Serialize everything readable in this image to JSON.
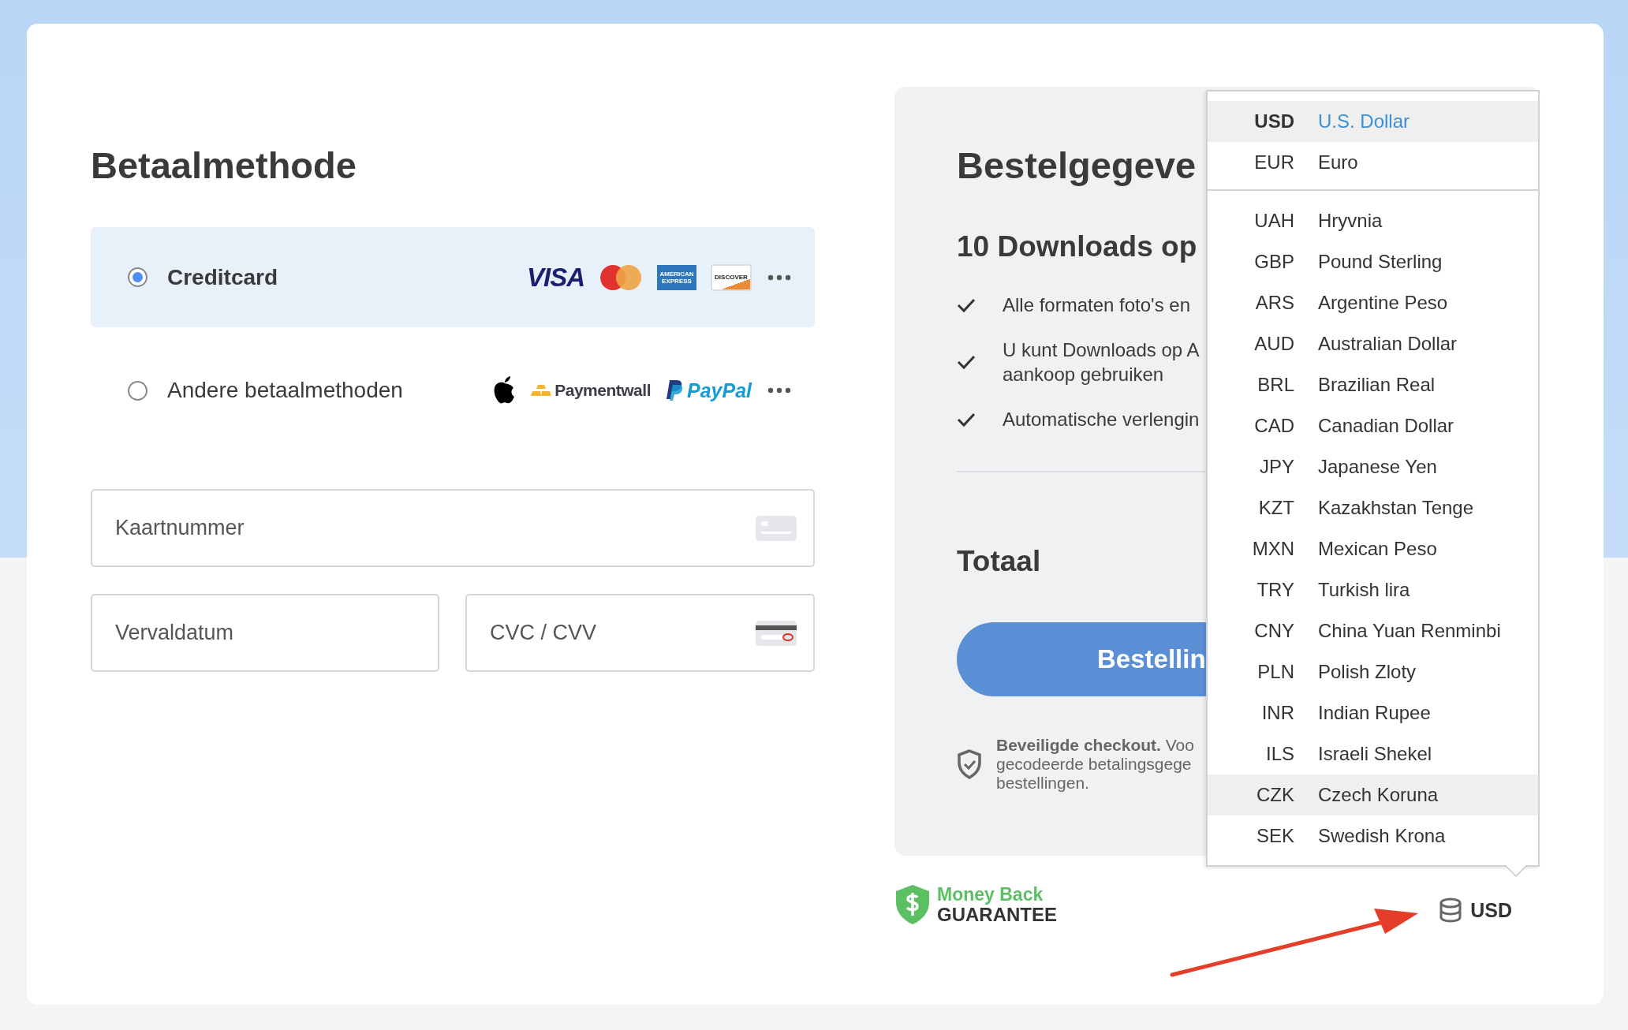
{
  "payment": {
    "title": "Betaalmethode",
    "methods": [
      {
        "label": "Creditcard",
        "selected": true,
        "logos": [
          {
            "kind": "visa",
            "text": "VISA"
          },
          {
            "kind": "mastercard"
          },
          {
            "kind": "amex",
            "text": "AMERICAN EXPRESS"
          },
          {
            "kind": "discover",
            "text": "DISCOVER"
          },
          {
            "kind": "more"
          }
        ]
      },
      {
        "label": "Andere betaalmethoden",
        "selected": false,
        "logos": [
          {
            "kind": "apple"
          },
          {
            "kind": "paymentwall",
            "text": "Paymentwall"
          },
          {
            "kind": "paypal",
            "text": "PayPal"
          },
          {
            "kind": "more"
          }
        ]
      }
    ]
  },
  "card_fields": [
    {
      "placeholder": "Kaartnummer",
      "kind": "card"
    },
    {
      "placeholder": "Vervaldatum",
      "kind": "plain"
    },
    {
      "placeholder": "CVC / CVV",
      "kind": "cvc"
    }
  ],
  "order": {
    "title": "Bestelgegeve",
    "subtitle": "10 Downloads op",
    "features": [
      {
        "lines": [
          "Alle formaten foto's en"
        ]
      },
      {
        "lines": [
          "U kunt Downloads op A",
          "aankoop gebruiken"
        ]
      },
      {
        "lines": [
          "Automatische verlengin"
        ]
      }
    ],
    "total_label": "Totaal",
    "order_button": "Bestellin",
    "secure_lines": [
      "**Beveiligde checkout.** Voo",
      "gecodeerde betalingsgege",
      "bestellingen."
    ]
  },
  "money_back": {
    "line_1": "Money Back",
    "line_2": "GUARANTEE"
  },
  "currency_button": {
    "label": "USD"
  },
  "currency_menu": {
    "pinned": [
      {
        "code": "USD",
        "name": "U.S. Dollar",
        "selected": true,
        "hovered": false
      },
      {
        "code": "EUR",
        "name": "Euro",
        "selected": false,
        "hovered": false
      }
    ],
    "items": [
      {
        "code": "UAH",
        "name": "Hryvnia",
        "selected": false,
        "hovered": false
      },
      {
        "code": "GBP",
        "name": "Pound Sterling",
        "selected": false,
        "hovered": false
      },
      {
        "code": "ARS",
        "name": "Argentine Peso",
        "selected": false,
        "hovered": false
      },
      {
        "code": "AUD",
        "name": "Australian Dollar",
        "selected": false,
        "hovered": false
      },
      {
        "code": "BRL",
        "name": "Brazilian Real",
        "selected": false,
        "hovered": false
      },
      {
        "code": "CAD",
        "name": "Canadian Dollar",
        "selected": false,
        "hovered": false
      },
      {
        "code": "JPY",
        "name": "Japanese Yen",
        "selected": false,
        "hovered": false
      },
      {
        "code": "KZT",
        "name": "Kazakhstan Tenge",
        "selected": false,
        "hovered": false
      },
      {
        "code": "MXN",
        "name": "Mexican Peso",
        "selected": false,
        "hovered": false
      },
      {
        "code": "TRY",
        "name": "Turkish lira",
        "selected": false,
        "hovered": false
      },
      {
        "code": "CNY",
        "name": "China Yuan Renminbi",
        "selected": false,
        "hovered": false
      },
      {
        "code": "PLN",
        "name": "Polish Zloty",
        "selected": false,
        "hovered": false
      },
      {
        "code": "INR",
        "name": "Indian Rupee",
        "selected": false,
        "hovered": false
      },
      {
        "code": "ILS",
        "name": "Israeli Shekel",
        "selected": false,
        "hovered": false
      },
      {
        "code": "CZK",
        "name": "Czech Koruna",
        "selected": false,
        "hovered": true
      },
      {
        "code": "SEK",
        "name": "Swedish Krona",
        "selected": false,
        "hovered": false
      }
    ]
  }
}
